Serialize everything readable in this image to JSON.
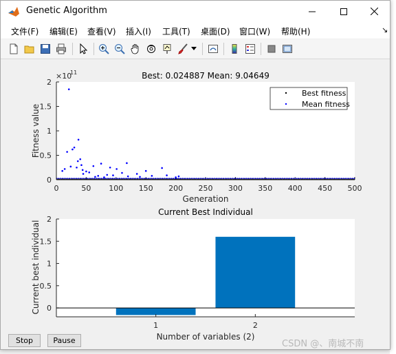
{
  "window": {
    "title": "Genetic Algorithm"
  },
  "menu": [
    "文件(F)",
    "编辑(E)",
    "查看(V)",
    "插入(I)",
    "工具(T)",
    "桌面(D)",
    "窗口(W)",
    "帮助(H)"
  ],
  "toolbar_icons": [
    "new-file-icon",
    "open-folder-icon",
    "save-icon",
    "print-icon",
    "pointer-icon",
    "zoom-in-icon",
    "zoom-out-icon",
    "pan-hand-icon",
    "rotate-3d-icon",
    "data-cursor-icon",
    "brush-icon",
    "link-plot-icon",
    "colorbar-icon",
    "legend-icon",
    "hide-plot-tools-icon",
    "show-plot-tools-icon"
  ],
  "buttons": {
    "stop": "Stop",
    "pause": "Pause"
  },
  "watermark": "CSDN @、南城不南",
  "colors": {
    "series": "#0000ff",
    "best": "#000000",
    "bar": "#0072bd"
  },
  "chart_data": [
    {
      "type": "scatter",
      "title": "Best: 0.024887 Mean: 9.04649",
      "xlabel": "Generation",
      "ylabel": "Fitness value",
      "exponent_label": "×10",
      "exponent_value": "11",
      "xlim": [
        0,
        500
      ],
      "ylim": [
        0,
        2
      ],
      "xticks": [
        "0",
        "50",
        "100",
        "150",
        "200",
        "250",
        "300",
        "350",
        "400",
        "450",
        "500"
      ],
      "yticks": [
        "0",
        "0.5",
        "1",
        "1.5",
        "2"
      ],
      "legend": [
        "Best fitness",
        "Mean fitness"
      ],
      "legend_position": "top-right",
      "series": [
        {
          "name": "Best fitness",
          "x": [
            1,
            500
          ],
          "y": [
            0,
            0
          ]
        },
        {
          "name": "Mean fitness",
          "x": [
            21,
            37,
            36,
            27,
            30,
            40,
            42,
            24,
            34,
            18,
            14,
            10,
            44,
            50,
            62,
            75,
            90,
            101,
            118,
            135,
            150,
            177,
            185,
            205,
            45,
            55,
            70,
            85,
            110,
            160,
            65,
            80,
            95,
            120,
            140,
            200
          ],
          "y": [
            1.85,
            0.82,
            0.38,
            0.62,
            0.66,
            0.42,
            0.3,
            0.27,
            0.25,
            0.57,
            0.22,
            0.18,
            0.2,
            0.17,
            0.28,
            0.33,
            0.25,
            0.22,
            0.34,
            0.12,
            0.18,
            0.24,
            0.09,
            0.07,
            0.12,
            0.15,
            0.08,
            0.1,
            0.14,
            0.08,
            0.06,
            0.05,
            0.09,
            0.07,
            0.06,
            0.05
          ]
        }
      ]
    },
    {
      "type": "bar",
      "title": "Current Best Individual",
      "xlabel": "Number of variables (2)",
      "ylabel": "Current best individual",
      "categories": [
        "1",
        "2"
      ],
      "values": [
        -0.16,
        1.6
      ],
      "ylim": [
        -0.2,
        2
      ],
      "yticks": [
        "0",
        "0.5",
        "1",
        "1.5",
        "2"
      ]
    }
  ]
}
